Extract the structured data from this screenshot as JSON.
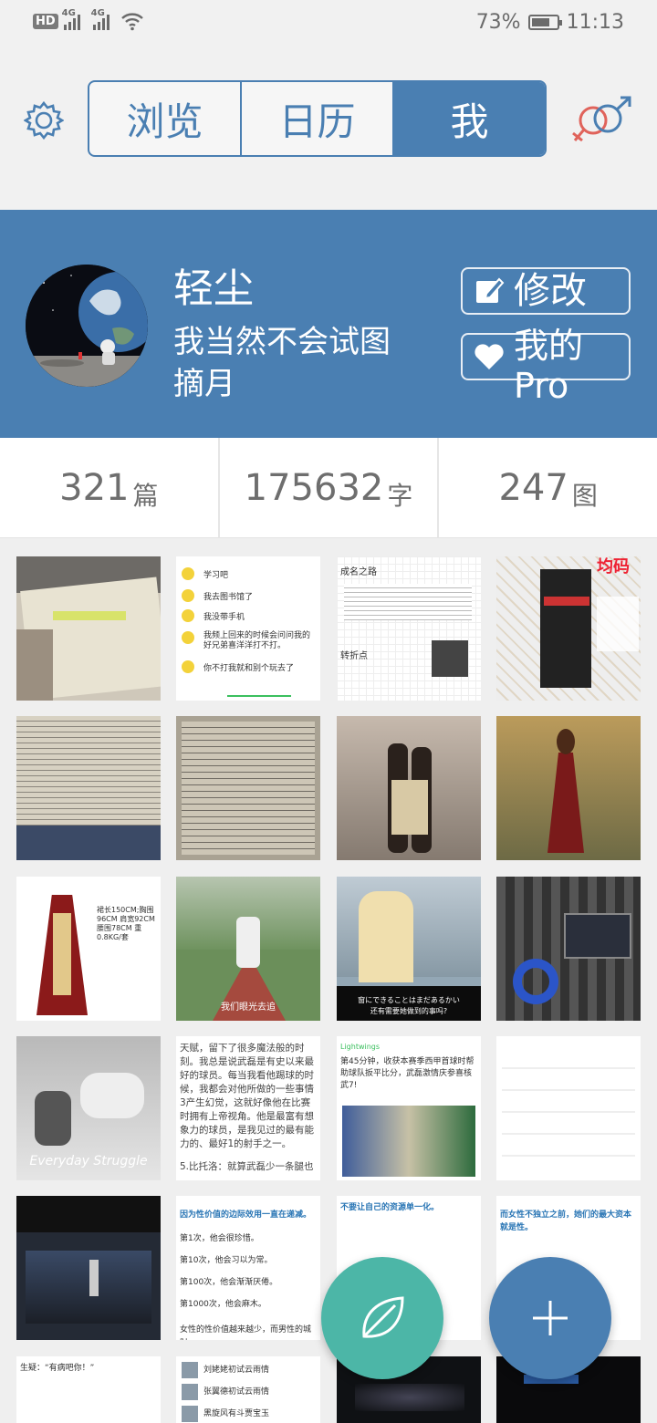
{
  "status_bar": {
    "hd_badge": "HD",
    "sim1_label": "4G",
    "sim2_label": "4G",
    "battery_percent": "73%",
    "battery_level": 0.73,
    "time": "11:13"
  },
  "header": {
    "tabs": [
      {
        "label": "浏览",
        "active": false
      },
      {
        "label": "日历",
        "active": false
      },
      {
        "label": "我",
        "active": true
      }
    ],
    "accent_color": "#4a7fb2"
  },
  "profile": {
    "name": "轻尘",
    "motto": "我当然不会试图摘月",
    "edit_button_label": "修改",
    "pro_button_label": "我的Pro"
  },
  "stats": [
    {
      "value": "321",
      "unit": "篇"
    },
    {
      "value": "175632",
      "unit": "字"
    },
    {
      "value": "247",
      "unit": "图"
    }
  ],
  "grid": {
    "thumb_texts": {
      "chat_lines": [
        "学习吧",
        "我去图书馆了",
        "我没带手机",
        "我频上回来的时候会问问我的好兄弟喜洋洋打不打。",
        "你不打我就和别个玩去了"
      ],
      "doc_title": "成名之路",
      "doc_subtitle": "转折点",
      "shop_banner": "均码",
      "dress_size": "裙长150CM;胸围96CM 肩宽92CM腰围78CM 重0.8KG/套",
      "subtitle_chinese": "我们眼光去追",
      "subtitle_japanese": "窗にできることはまだあるかい",
      "subtitle_chinese2": "还有需要她做到的事吗?",
      "everyday": "Everyday Struggle",
      "article_paragraph": "天赋，留下了很多魔法般的时刻。我总是说武磊是有史以来最好的球员。每当我看他踢球的时候，我都会对他所做的一些事情3产生幻觉，这就好像他在比赛时拥有上帝视角。他是最富有想象力的球员，是我见过的最有能力的、最好1的射手之一。",
      "article_item": "5.比托洛：就算武磊少一条腿也",
      "news_source": "Lightwings",
      "news_headline": "第45分钟，收获本赛季西甲首球时帮助球队扳平比分，武磊激情庆参喜核武7!",
      "blue_quote_1": "因为性价值的边际效用一直在递减。",
      "blue_quote_lines": [
        "第1次，他会很珍惜。",
        "第10次，他会习以为常。",
        "第100次，他会渐渐厌倦。",
        "第1000次，他会麻木。",
        "女性的性价值越来越少，而男性的城财"
      ],
      "blue_quote_2": "不要让自己的资源单一化。",
      "blue_quote_3": "而女性不独立之前，她们的最大资本就是性。",
      "last_row_text": "生疑：“有病吧你！”",
      "contact_list": [
        "刘姥姥初试云雨情",
        "张翼德初试云雨情",
        "黑旋风有斗贾宝玉"
      ]
    }
  },
  "fab": {
    "leaf_icon": "leaf-icon",
    "plus_icon": "plus-icon",
    "leaf_color": "#4cb6a7",
    "plus_color": "#4a7fb2"
  }
}
